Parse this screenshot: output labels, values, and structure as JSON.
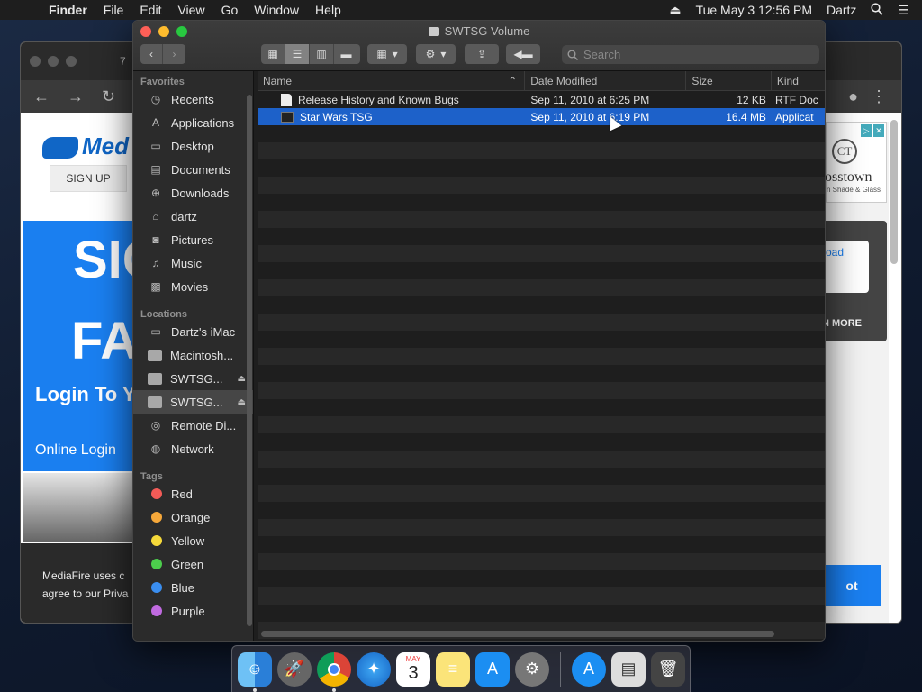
{
  "menubar": {
    "app": "Finder",
    "items": [
      "File",
      "Edit",
      "View",
      "Go",
      "Window",
      "Help"
    ],
    "datetime": "Tue May 3  12:56 PM",
    "user": "Dartz"
  },
  "browser": {
    "tab_title": "7",
    "logo": "Med",
    "signup": "SIGN UP",
    "hero_big1": "SIG",
    "hero_big2": "FA",
    "hero_login": "Login To Y Faster",
    "hero_online": "Online Login",
    "cookie": "MediaFire uses c agree to our Priva",
    "ad_monogram": "CT",
    "ad_brand": "osstown",
    "ad_sub": "n Shade & Glass",
    "download_link": "oad",
    "learn_more": "N MORE",
    "blue_btn": "ot"
  },
  "finder": {
    "title": "SWTSG Volume",
    "search_placeholder": "Search",
    "sidebar": {
      "favorites_header": "Favorites",
      "favorites": [
        "Recents",
        "Applications",
        "Desktop",
        "Documents",
        "Downloads",
        "dartz",
        "Pictures",
        "Music",
        "Movies"
      ],
      "locations_header": "Locations",
      "locations": [
        "Dartz's iMac",
        "Macintosh...",
        "SWTSG...",
        "SWTSG...",
        "Remote Di...",
        "Network"
      ],
      "tags_header": "Tags",
      "tags": [
        {
          "label": "Red",
          "color": "#f25b57"
        },
        {
          "label": "Orange",
          "color": "#f6a83a"
        },
        {
          "label": "Yellow",
          "color": "#f5d93a"
        },
        {
          "label": "Green",
          "color": "#4ccd4c"
        },
        {
          "label": "Blue",
          "color": "#3a8ef0"
        },
        {
          "label": "Purple",
          "color": "#c06ae0"
        }
      ]
    },
    "columns": {
      "name": "Name",
      "date": "Date Modified",
      "size": "Size",
      "kind": "Kind"
    },
    "files": [
      {
        "name": "Release History and Known Bugs",
        "date": "Sep 11, 2010 at 6:25 PM",
        "size": "12 KB",
        "kind": "RTF Doc"
      },
      {
        "name": "Star Wars TSG",
        "date": "Sep 11, 2010 at 6:19 PM",
        "size": "16.4 MB",
        "kind": "Applicat"
      }
    ]
  },
  "dock": {
    "calendar_month": "MAY",
    "calendar_day": "3"
  }
}
